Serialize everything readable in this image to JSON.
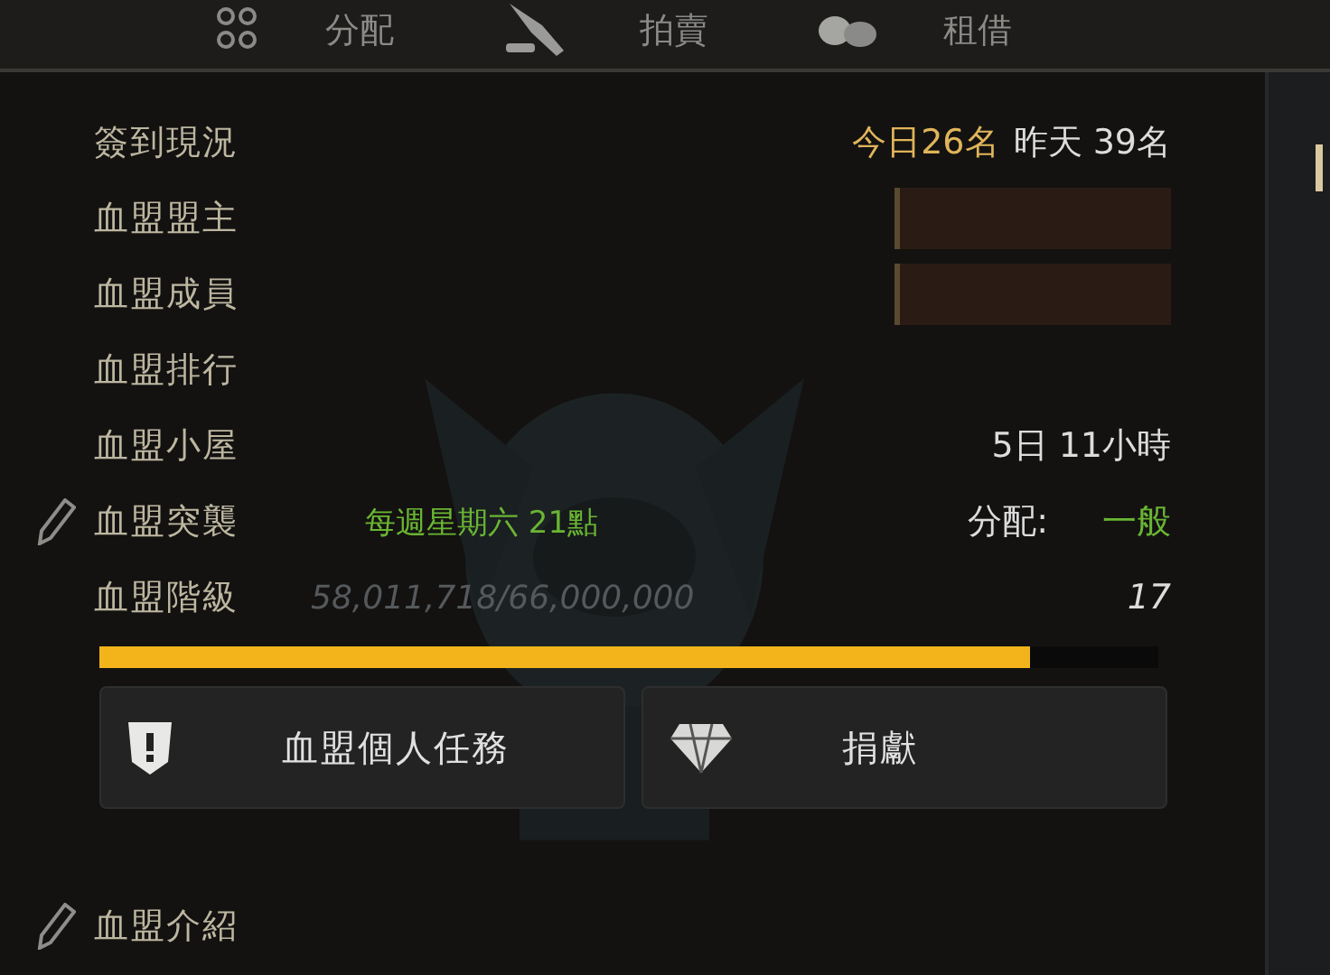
{
  "tabs": [
    {
      "label": "分配"
    },
    {
      "label": "拍賣"
    },
    {
      "label": "租借"
    }
  ],
  "rows": [
    {
      "kind": "checkin",
      "label": "簽到現況",
      "today": "今日26名",
      "yesterday": "昨天 39名"
    },
    {
      "kind": "redacted",
      "label": "血盟盟主"
    },
    {
      "kind": "redacted",
      "label": "血盟成員"
    },
    {
      "kind": "plain",
      "label": "血盟排行"
    },
    {
      "kind": "plain",
      "label": "血盟小屋",
      "value": "5日 11小時"
    },
    {
      "kind": "raid",
      "label": "血盟突襲",
      "editable": true,
      "schedule": "每週星期六 21點",
      "dist_label": "分配:",
      "dist_value": "一般"
    },
    {
      "kind": "level",
      "label": "血盟階級",
      "exp": "58,011,718/66,000,000",
      "value": "17",
      "level": 0.879
    }
  ],
  "buttons": [
    {
      "label": "血盟個人任務"
    },
    {
      "label": "捐獻"
    }
  ],
  "footer": {
    "label": "血盟介紹",
    "editable": true
  }
}
